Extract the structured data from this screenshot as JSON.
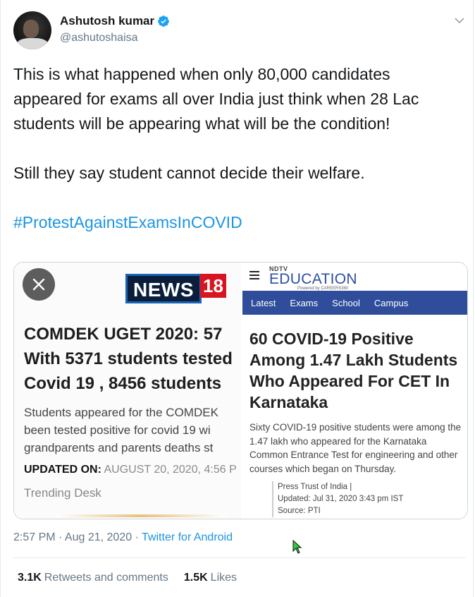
{
  "user": {
    "display_name": "Ashutosh kumar",
    "handle": "@ashutoshaisa",
    "verified": true
  },
  "tweet": {
    "paragraphs": [
      "This is what happened when only 80,000 candidates appeared for exams all over India just think when 28 Lac students will be appearing what will be the condition!",
      "Still they say student cannot decide their welfare."
    ],
    "hashtag": "#ProtestAgainstExamsInCOVID"
  },
  "media": {
    "left": {
      "logo_text": "NEWS",
      "logo_number": "18",
      "headline_lines": [
        "COMDEK UGET 2020:  57",
        "With 5371 students tested",
        "Covid 19 , 8456 students"
      ],
      "sub_lines": [
        "Students appeared for the COMDEK",
        "been tested positive for covid 19 wi",
        "grandparents and parents deaths st"
      ],
      "updated_label": "UPDATED ON:",
      "updated_value": "AUGUST 20, 2020, 4:56 P",
      "desk": "Trending Desk"
    },
    "right": {
      "brand_top": "NDTV",
      "brand_main": "EDUCATION",
      "brand_powered": "Powered by CAREERS360",
      "nav": [
        "Latest",
        "Exams",
        "School",
        "Campus"
      ],
      "headline": "60 COVID-19 Positive Among 1.47 Lakh Students Who Appeared For CET In Karnataka",
      "body": "Sixty COVID-19 positive students were among the 1.47 lakh who appeared for the Karnataka Common Entrance Test for engineering and other courses which began on Thursday.",
      "meta": [
        "Press Trust of India |",
        "Updated: Jul 31, 2020 3:43 pm IST",
        "Source: PTI"
      ]
    }
  },
  "footer": {
    "time": "2:57 PM · Aug 21, 2020 · ",
    "source": "Twitter for Android",
    "retweets_count": "3.1K",
    "retweets_label": "Retweets and comments",
    "likes_count": "1.5K",
    "likes_label": "Likes"
  },
  "colors": {
    "link": "#1b95e0",
    "muted": "#657786",
    "news18_red": "#d7141f",
    "ndtv_nav": "#2f4d9a"
  }
}
